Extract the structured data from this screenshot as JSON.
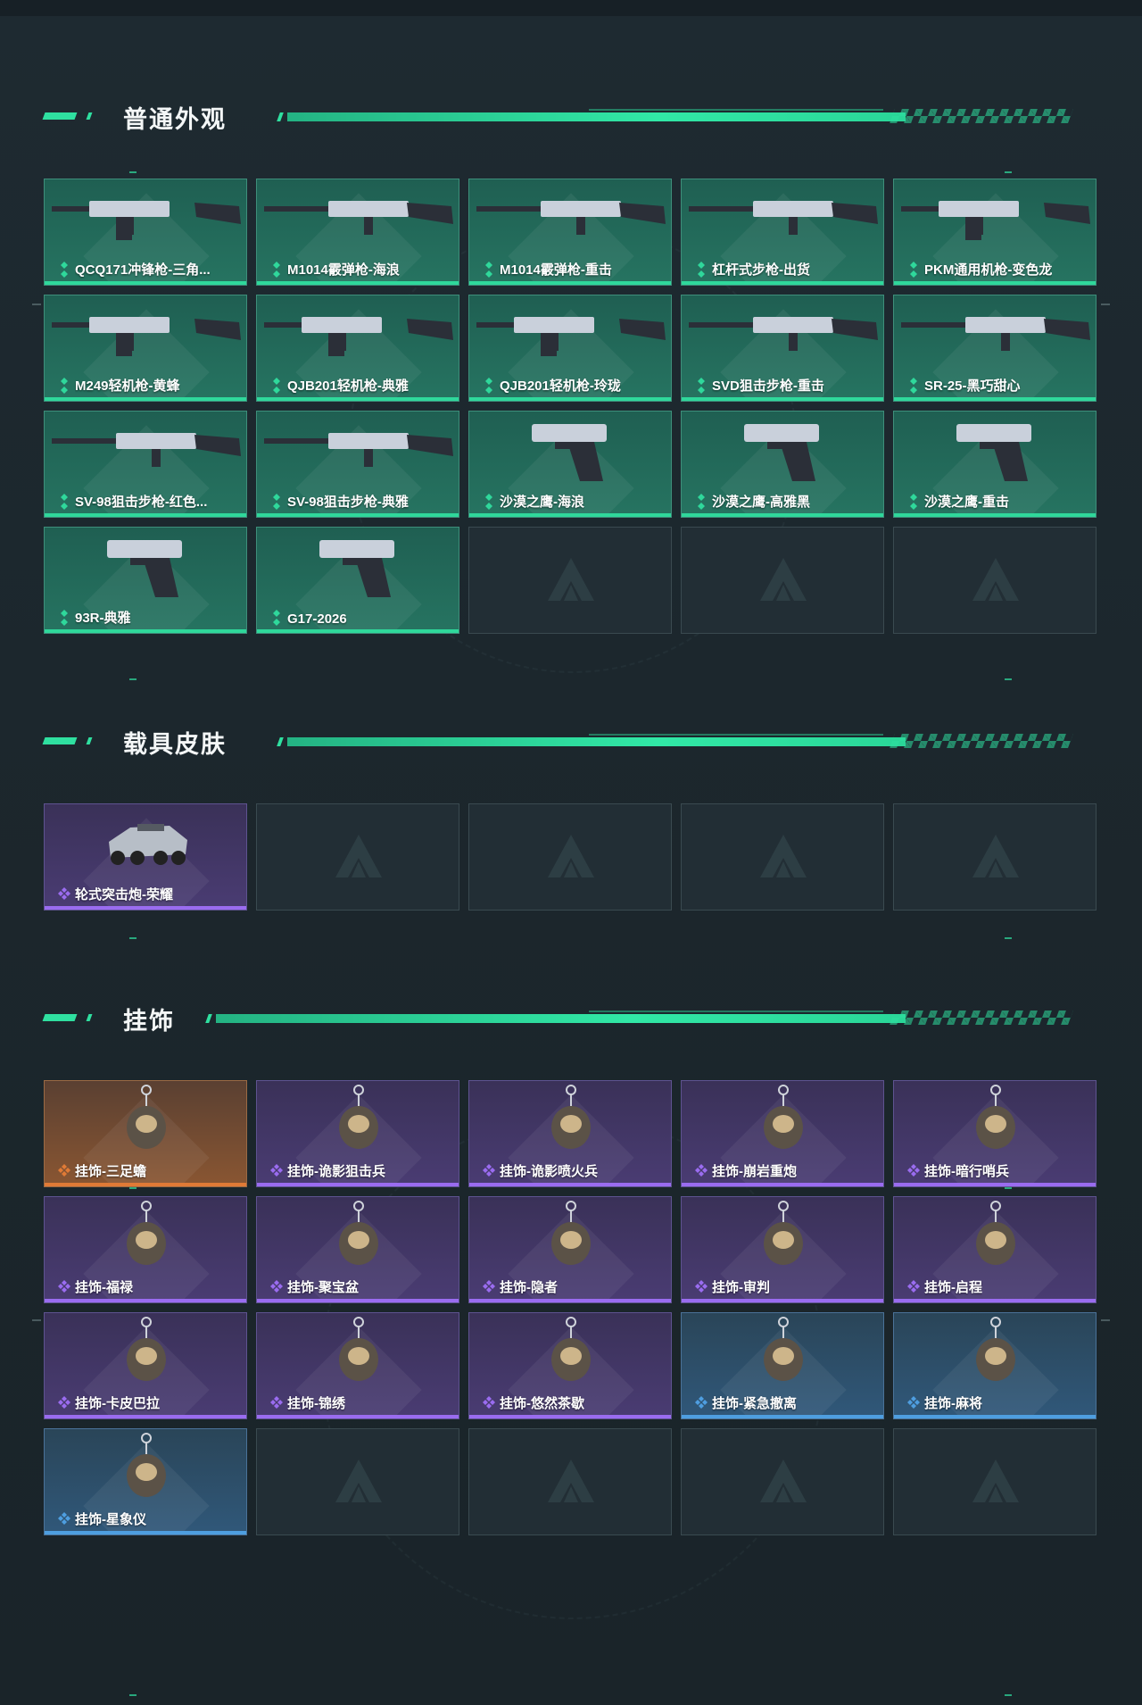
{
  "sections": {
    "weapons": {
      "title": "普通外观",
      "items": [
        {
          "name": "QCQ171冲锋枪-三角...",
          "rarity": "green",
          "icon": "smg-icon"
        },
        {
          "name": "M1014霰弹枪-海浪",
          "rarity": "green",
          "icon": "shotgun-icon"
        },
        {
          "name": "M1014霰弹枪-重击",
          "rarity": "green",
          "icon": "shotgun-icon"
        },
        {
          "name": "杠杆式步枪-出货",
          "rarity": "green",
          "icon": "rifle-icon"
        },
        {
          "name": "PKM通用机枪-变色龙",
          "rarity": "green",
          "icon": "machine-gun-icon"
        },
        {
          "name": "M249轻机枪-黄蜂",
          "rarity": "green",
          "icon": "machine-gun-icon"
        },
        {
          "name": "QJB201轻机枪-典雅",
          "rarity": "green",
          "icon": "machine-gun-icon"
        },
        {
          "name": "QJB201轻机枪-玲珑",
          "rarity": "green",
          "icon": "machine-gun-icon"
        },
        {
          "name": "SVD狙击步枪-重击",
          "rarity": "green",
          "icon": "sniper-rifle-icon"
        },
        {
          "name": "SR-25-黑巧甜心",
          "rarity": "green",
          "icon": "rifle-icon"
        },
        {
          "name": "SV-98狙击步枪-红色...",
          "rarity": "green",
          "icon": "sniper-rifle-icon"
        },
        {
          "name": "SV-98狙击步枪-典雅",
          "rarity": "green",
          "icon": "sniper-rifle-icon"
        },
        {
          "name": "沙漠之鹰-海浪",
          "rarity": "green",
          "icon": "pistol-icon"
        },
        {
          "name": "沙漠之鹰-高雅黑",
          "rarity": "green",
          "icon": "pistol-icon"
        },
        {
          "name": "沙漠之鹰-重击",
          "rarity": "green",
          "icon": "pistol-icon"
        },
        {
          "name": "93R-典雅",
          "rarity": "green",
          "icon": "pistol-icon"
        },
        {
          "name": "G17-2026",
          "rarity": "green",
          "icon": "pistol-icon"
        }
      ],
      "empty_slots": 3
    },
    "vehicles": {
      "title": "载具皮肤",
      "items": [
        {
          "name": "轮式突击炮-荣耀",
          "rarity": "purple",
          "icon": "armored-vehicle-icon"
        }
      ],
      "empty_slots": 4
    },
    "charms": {
      "title": "挂饰",
      "items": [
        {
          "name": "挂饰-三足蟾",
          "rarity": "orange",
          "icon": "toad-charm-icon"
        },
        {
          "name": "挂饰-诡影狙击兵",
          "rarity": "purple",
          "icon": "charm-icon"
        },
        {
          "name": "挂饰-诡影喷火兵",
          "rarity": "purple",
          "icon": "charm-icon"
        },
        {
          "name": "挂饰-崩岩重炮",
          "rarity": "purple",
          "icon": "charm-icon"
        },
        {
          "name": "挂饰-暗行哨兵",
          "rarity": "purple",
          "icon": "charm-icon"
        },
        {
          "name": "挂饰-福禄",
          "rarity": "purple",
          "icon": "gourd-charm-icon"
        },
        {
          "name": "挂饰-聚宝盆",
          "rarity": "purple",
          "icon": "treasure-bowl-charm-icon"
        },
        {
          "name": "挂饰-隐者",
          "rarity": "purple",
          "icon": "tarot-card-charm-icon"
        },
        {
          "name": "挂饰-审判",
          "rarity": "purple",
          "icon": "tarot-card-charm-icon"
        },
        {
          "name": "挂饰-启程",
          "rarity": "purple",
          "icon": "ring-charm-icon"
        },
        {
          "name": "挂饰-卡皮巴拉",
          "rarity": "purple",
          "icon": "capybara-charm-icon"
        },
        {
          "name": "挂饰-锦绣",
          "rarity": "purple",
          "icon": "butterfly-charm-icon"
        },
        {
          "name": "挂饰-悠然茶歇",
          "rarity": "purple",
          "icon": "cupcake-charm-icon"
        },
        {
          "name": "挂饰-紧急撤离",
          "rarity": "blue",
          "icon": "charm-icon"
        },
        {
          "name": "挂饰-麻将",
          "rarity": "blue",
          "icon": "mahjong-tile-charm-icon"
        },
        {
          "name": "挂饰-星象仪",
          "rarity": "blue",
          "icon": "astrolabe-charm-icon"
        }
      ],
      "empty_slots": 4
    }
  },
  "colors": {
    "accent": "#2fe0a0",
    "rarity_green": "#2fd89b",
    "rarity_purple": "#9a6cf0",
    "rarity_orange": "#e07a36",
    "rarity_blue": "#4e9ee0"
  }
}
